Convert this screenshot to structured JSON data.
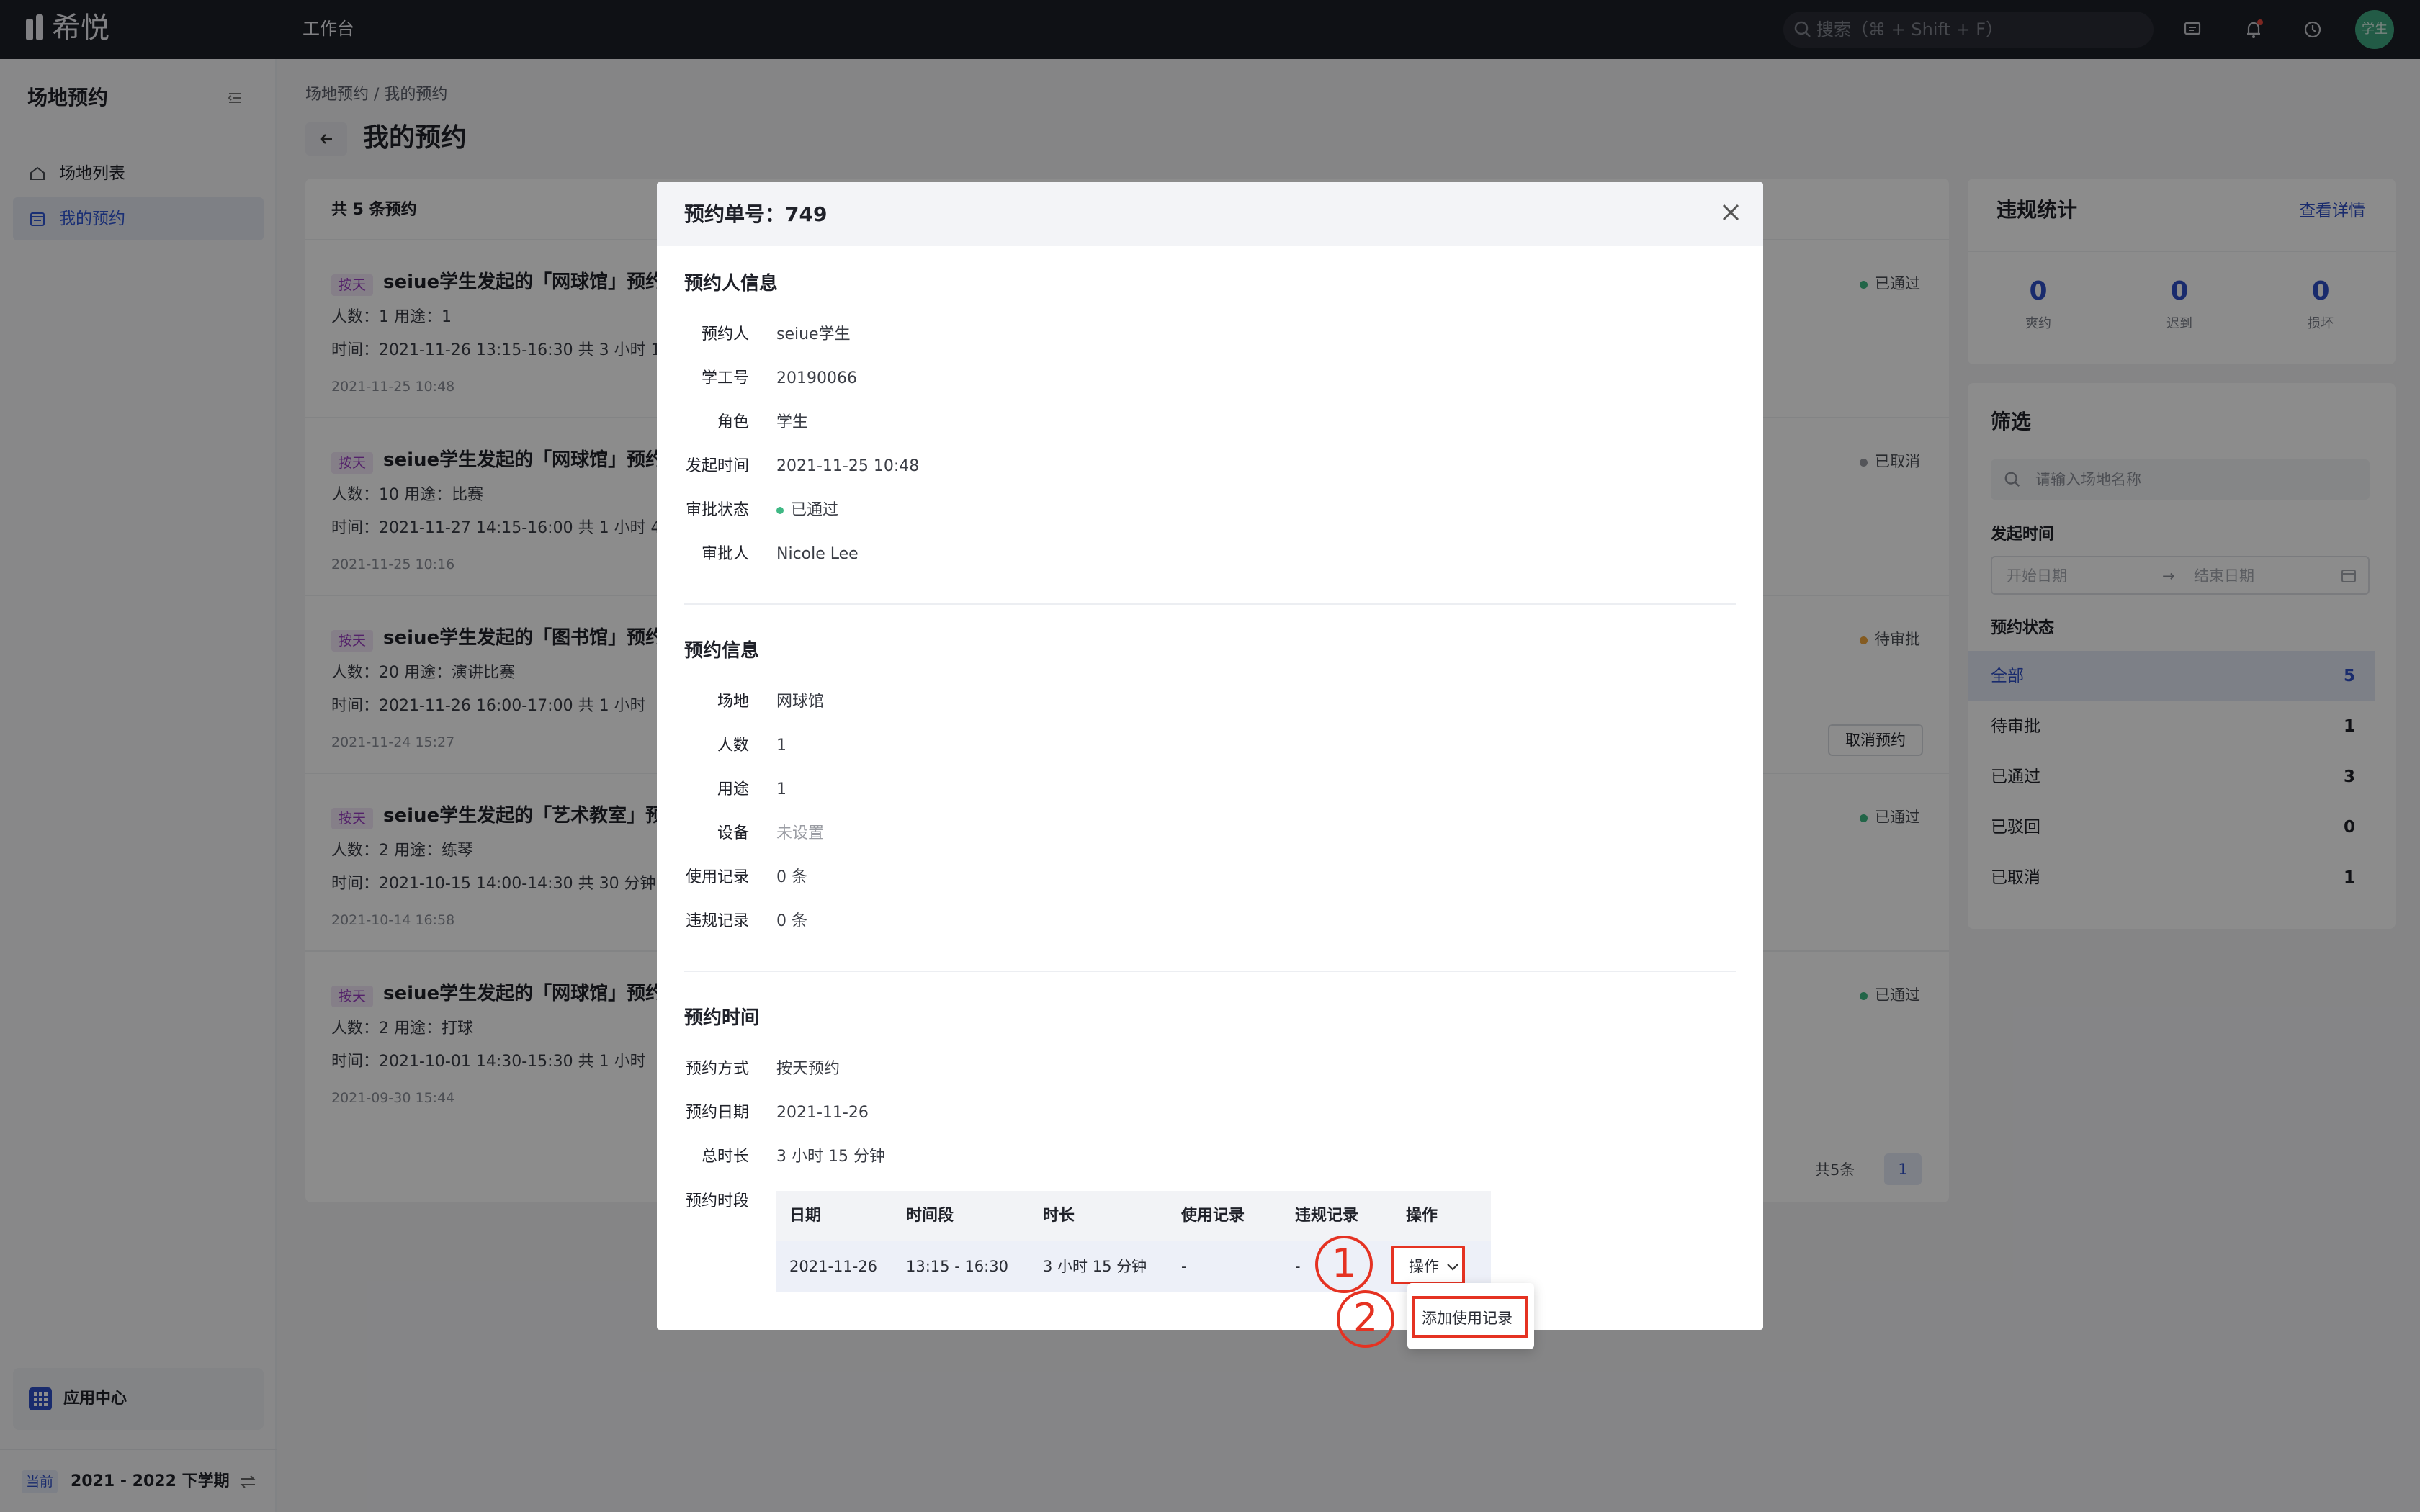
{
  "app": {
    "logo_text": "希悦",
    "nav_label": "工作台",
    "search_placeholder": "搜索（⌘ + Shift + F）",
    "avatar_text": "学生"
  },
  "sidebar": {
    "title": "场地预约",
    "items": [
      {
        "label": "场地列表"
      },
      {
        "label": "我的预约"
      }
    ],
    "app_center": "应用中心",
    "term_current": "当前",
    "term_label": "2021 - 2022 下学期"
  },
  "page": {
    "breadcrumb": "场地预约  /  我的预约",
    "title": "我的预约"
  },
  "list": {
    "summary": "共 5 条预约",
    "items": [
      {
        "tag": "按天",
        "title": "seiue学生发起的「网球馆」预约",
        "line1": "人数：1   用途：1",
        "line2": "时间：2021-11-26   13:15-16:30   共 3 小时 1",
        "date": "2021-11-25 10:48",
        "status": "已通过"
      },
      {
        "tag": "按天",
        "title": "seiue学生发起的「网球馆」预约",
        "line1": "人数：10   用途：比赛",
        "line2": "时间：2021-11-27   14:15-16:00   共 1 小时 4",
        "date": "2021-11-25 10:16",
        "status": "已取消"
      },
      {
        "tag": "按天",
        "title": "seiue学生发起的「图书馆」预约",
        "line1": "人数：20   用途：演讲比赛",
        "line2": "时间：2021-11-26   16:00-17:00   共 1 小时",
        "date": "2021-11-24 15:27",
        "status": "待审批",
        "action": "取消预约"
      },
      {
        "tag": "按天",
        "title": "seiue学生发起的「艺术教室」预",
        "line1": "人数：2   用途：练琴",
        "line2": "时间：2021-10-15   14:00-14:30   共 30 分钟",
        "date": "2021-10-14 16:58",
        "status": "已通过"
      },
      {
        "tag": "按天",
        "title": "seiue学生发起的「网球馆」预约",
        "line1": "人数：2   用途：打球",
        "line2": "时间：2021-10-01   14:30-15:30   共 1 小时",
        "date": "2021-09-30 15:44",
        "status": "已通过"
      }
    ],
    "pagination": {
      "total": "共5条",
      "page": "1"
    }
  },
  "violations": {
    "title": "违规统计",
    "link": "查看详情",
    "stats": [
      {
        "num": "0",
        "label": "爽约"
      },
      {
        "num": "0",
        "label": "迟到"
      },
      {
        "num": "0",
        "label": "损坏"
      }
    ]
  },
  "filter": {
    "title": "筛选",
    "search_placeholder": "请输入场地名称",
    "time_label": "发起时间",
    "start_placeholder": "开始日期",
    "end_placeholder": "结束日期",
    "status_label": "预约状态",
    "statuses": [
      {
        "label": "全部",
        "count": "5"
      },
      {
        "label": "待审批",
        "count": "1"
      },
      {
        "label": "已通过",
        "count": "3"
      },
      {
        "label": "已驳回",
        "count": "0"
      },
      {
        "label": "已取消",
        "count": "1"
      }
    ]
  },
  "modal": {
    "title": "预约单号：749",
    "booker": {
      "section": "预约人信息",
      "rows": [
        {
          "label": "预约人",
          "value": "seiue学生"
        },
        {
          "label": "学工号",
          "value": "20190066"
        },
        {
          "label": "角色",
          "value": "学生"
        },
        {
          "label": "发起时间",
          "value": "2021-11-25 10:48"
        },
        {
          "label": "审批状态",
          "value": "已通过"
        },
        {
          "label": "审批人",
          "value": "Nicole Lee"
        }
      ]
    },
    "booking": {
      "section": "预约信息",
      "rows": [
        {
          "label": "场地",
          "value": "网球馆"
        },
        {
          "label": "人数",
          "value": "1"
        },
        {
          "label": "用途",
          "value": "1"
        },
        {
          "label": "设备",
          "value": "未设置"
        },
        {
          "label": "使用记录",
          "value": "0 条"
        },
        {
          "label": "违规记录",
          "value": "0 条"
        }
      ]
    },
    "time": {
      "section": "预约时间",
      "rows": [
        {
          "label": "预约方式",
          "value": "按天预约"
        },
        {
          "label": "预约日期",
          "value": "2021-11-26"
        },
        {
          "label": "总时长",
          "value": "3 小时 15 分钟"
        }
      ],
      "slot_label": "预约时段",
      "table": {
        "headers": [
          "日期",
          "时间段",
          "时长",
          "使用记录",
          "违规记录",
          "操作"
        ],
        "row": [
          "2021-11-26",
          "13:15 - 16:30",
          "3 小时 15 分钟",
          "-",
          "-"
        ],
        "action_label": "操作"
      }
    },
    "dropdown_item": "添加使用记录",
    "markers": [
      "1",
      "2"
    ]
  },
  "colors": {
    "accent": "#2f4fc7",
    "approved": "#3fb884",
    "pending": "#f0a63c",
    "cancelled": "#9a9ca3",
    "highlight": "#e53222"
  }
}
